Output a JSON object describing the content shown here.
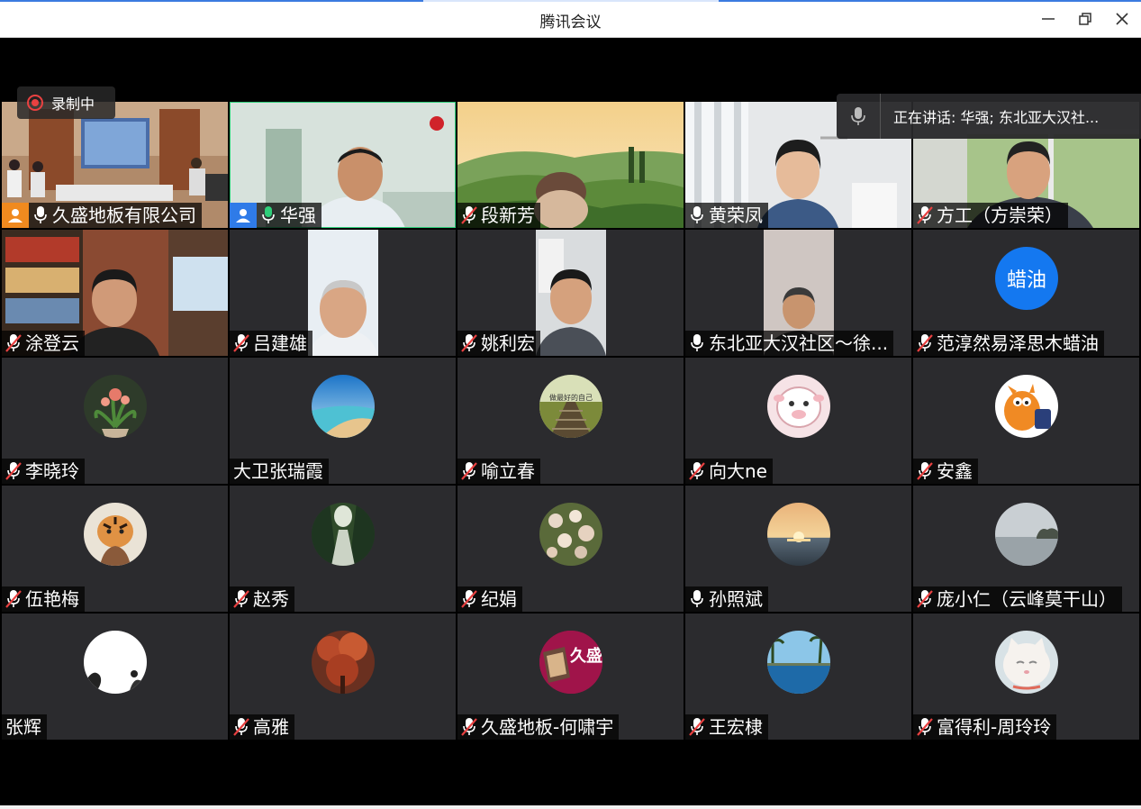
{
  "window": {
    "title": "腾讯会议"
  },
  "recording": {
    "label": "录制中"
  },
  "speaking": {
    "text": "正在讲话: 华强; 东北亚大汉社..."
  },
  "colors": {
    "accent_green": "#2fcf7a",
    "rec_red": "#e94141",
    "host_orange": "#f08a1f",
    "cohost_blue": "#2f7be8",
    "avatar_blue": "#1478f0"
  },
  "tiles": [
    {
      "name": "久盛地板有限公司",
      "mic": "on",
      "role": "host",
      "kind": "video"
    },
    {
      "name": "华强",
      "mic": "speaking",
      "role": "cohost",
      "kind": "video"
    },
    {
      "name": "段新芳",
      "mic": "muted",
      "kind": "video"
    },
    {
      "name": "黄荣凤",
      "mic": "on",
      "kind": "video"
    },
    {
      "name": "方工（方崇荣）",
      "mic": "muted",
      "kind": "video"
    },
    {
      "name": "涂登云",
      "mic": "muted",
      "kind": "video"
    },
    {
      "name": "吕建雄",
      "mic": "muted",
      "kind": "video"
    },
    {
      "name": "姚利宏",
      "mic": "muted",
      "kind": "video"
    },
    {
      "name": "东北亚大汉社区～徐...",
      "mic": "on",
      "kind": "video"
    },
    {
      "name": "范淳然易泽思木蜡油",
      "mic": "muted",
      "kind": "text-avatar",
      "avatar_text": "蜡油"
    },
    {
      "name": "李晓玲",
      "mic": "muted",
      "kind": "avatar",
      "avatar": "flower-pot"
    },
    {
      "name": "大卫张瑞霞",
      "mic": "none",
      "kind": "avatar",
      "avatar": "beach"
    },
    {
      "name": "喻立春",
      "mic": "muted",
      "kind": "avatar",
      "avatar": "rail-track",
      "avatar_text": "做最好的自己"
    },
    {
      "name": "向大ne",
      "mic": "muted",
      "kind": "avatar",
      "avatar": "sheep-cartoon"
    },
    {
      "name": "安鑫",
      "mic": "muted",
      "kind": "avatar",
      "avatar": "garfield"
    },
    {
      "name": "伍艳梅",
      "mic": "muted",
      "kind": "avatar",
      "avatar": "tiger"
    },
    {
      "name": "赵秀",
      "mic": "muted",
      "kind": "avatar",
      "avatar": "forest-road"
    },
    {
      "name": "纪娟",
      "mic": "muted",
      "kind": "avatar",
      "avatar": "blossoms"
    },
    {
      "name": "孙照斌",
      "mic": "on",
      "kind": "avatar",
      "avatar": "sunset-sea"
    },
    {
      "name": "庞小仁（云峰莫干山）",
      "mic": "muted",
      "kind": "avatar",
      "avatar": "lake-mist"
    },
    {
      "name": "张辉",
      "mic": "none",
      "kind": "avatar",
      "avatar": "ink-painting"
    },
    {
      "name": "高雅",
      "mic": "muted",
      "kind": "avatar",
      "avatar": "red-tree"
    },
    {
      "name": "久盛地板-何啸宇",
      "mic": "muted",
      "kind": "avatar",
      "avatar": "jiusheng-logo",
      "avatar_text": "久盛"
    },
    {
      "name": "王宏棣",
      "mic": "muted",
      "kind": "avatar",
      "avatar": "infinity-pool"
    },
    {
      "name": "富得利-周玲玲",
      "mic": "muted",
      "kind": "avatar",
      "avatar": "white-cat"
    }
  ]
}
